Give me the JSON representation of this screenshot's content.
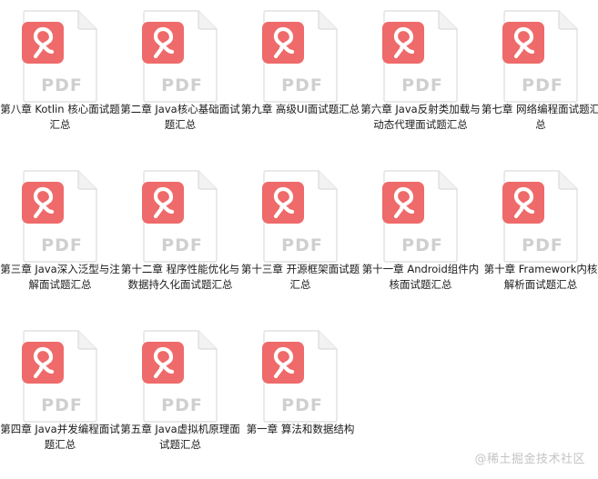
{
  "icon": {
    "name": "pdf-file-icon",
    "badge_color": "#ef6a6a",
    "label_color": "#cfcfcf",
    "label": "PDF"
  },
  "files": [
    {
      "name": "第八章 Kotlin 核心面试题汇总"
    },
    {
      "name": "第二章 Java核心基础面试题汇总"
    },
    {
      "name": "第九章 高级UI面试题汇总"
    },
    {
      "name": "第六章 Java反射类加载与动态代理面试题汇总"
    },
    {
      "name": "第七章 网络编程面试题汇总"
    },
    {
      "name": "第三章 Java深入泛型与注解面试题汇总"
    },
    {
      "name": "第十二章 程序性能优化与数据持久化面试题汇总"
    },
    {
      "name": "第十三章 开源框架面试题汇总"
    },
    {
      "name": "第十一章 Android组件内核面试题汇总"
    },
    {
      "name": "第十章 Framework内核解析面试题汇总"
    },
    {
      "name": "第四章 Java并发编程面试题汇总"
    },
    {
      "name": "第五章 Java虚拟机原理面试题汇总"
    },
    {
      "name": "第一章 算法和数据结构"
    }
  ],
  "watermark": "@稀土掘金技术社区"
}
